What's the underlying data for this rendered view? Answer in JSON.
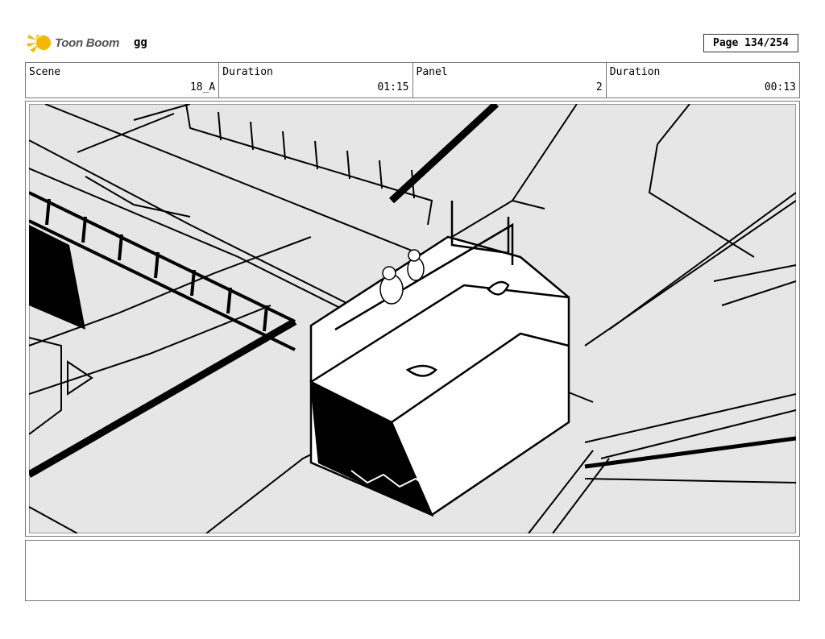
{
  "header": {
    "brand": "Toon Boom",
    "project": "gg",
    "page": "Page 134/254"
  },
  "info": [
    {
      "label": "Scene",
      "value": "18_A"
    },
    {
      "label": "Duration",
      "value": "01:15"
    },
    {
      "label": "Panel",
      "value": "2"
    },
    {
      "label": "Duration",
      "value": "00:13"
    }
  ],
  "panel": {
    "image_icon": "storyboard-drawing-icon",
    "colors": {
      "fill": "#e6e6e6",
      "line": "#000000",
      "white": "#ffffff"
    }
  },
  "notes": {
    "text": ""
  }
}
